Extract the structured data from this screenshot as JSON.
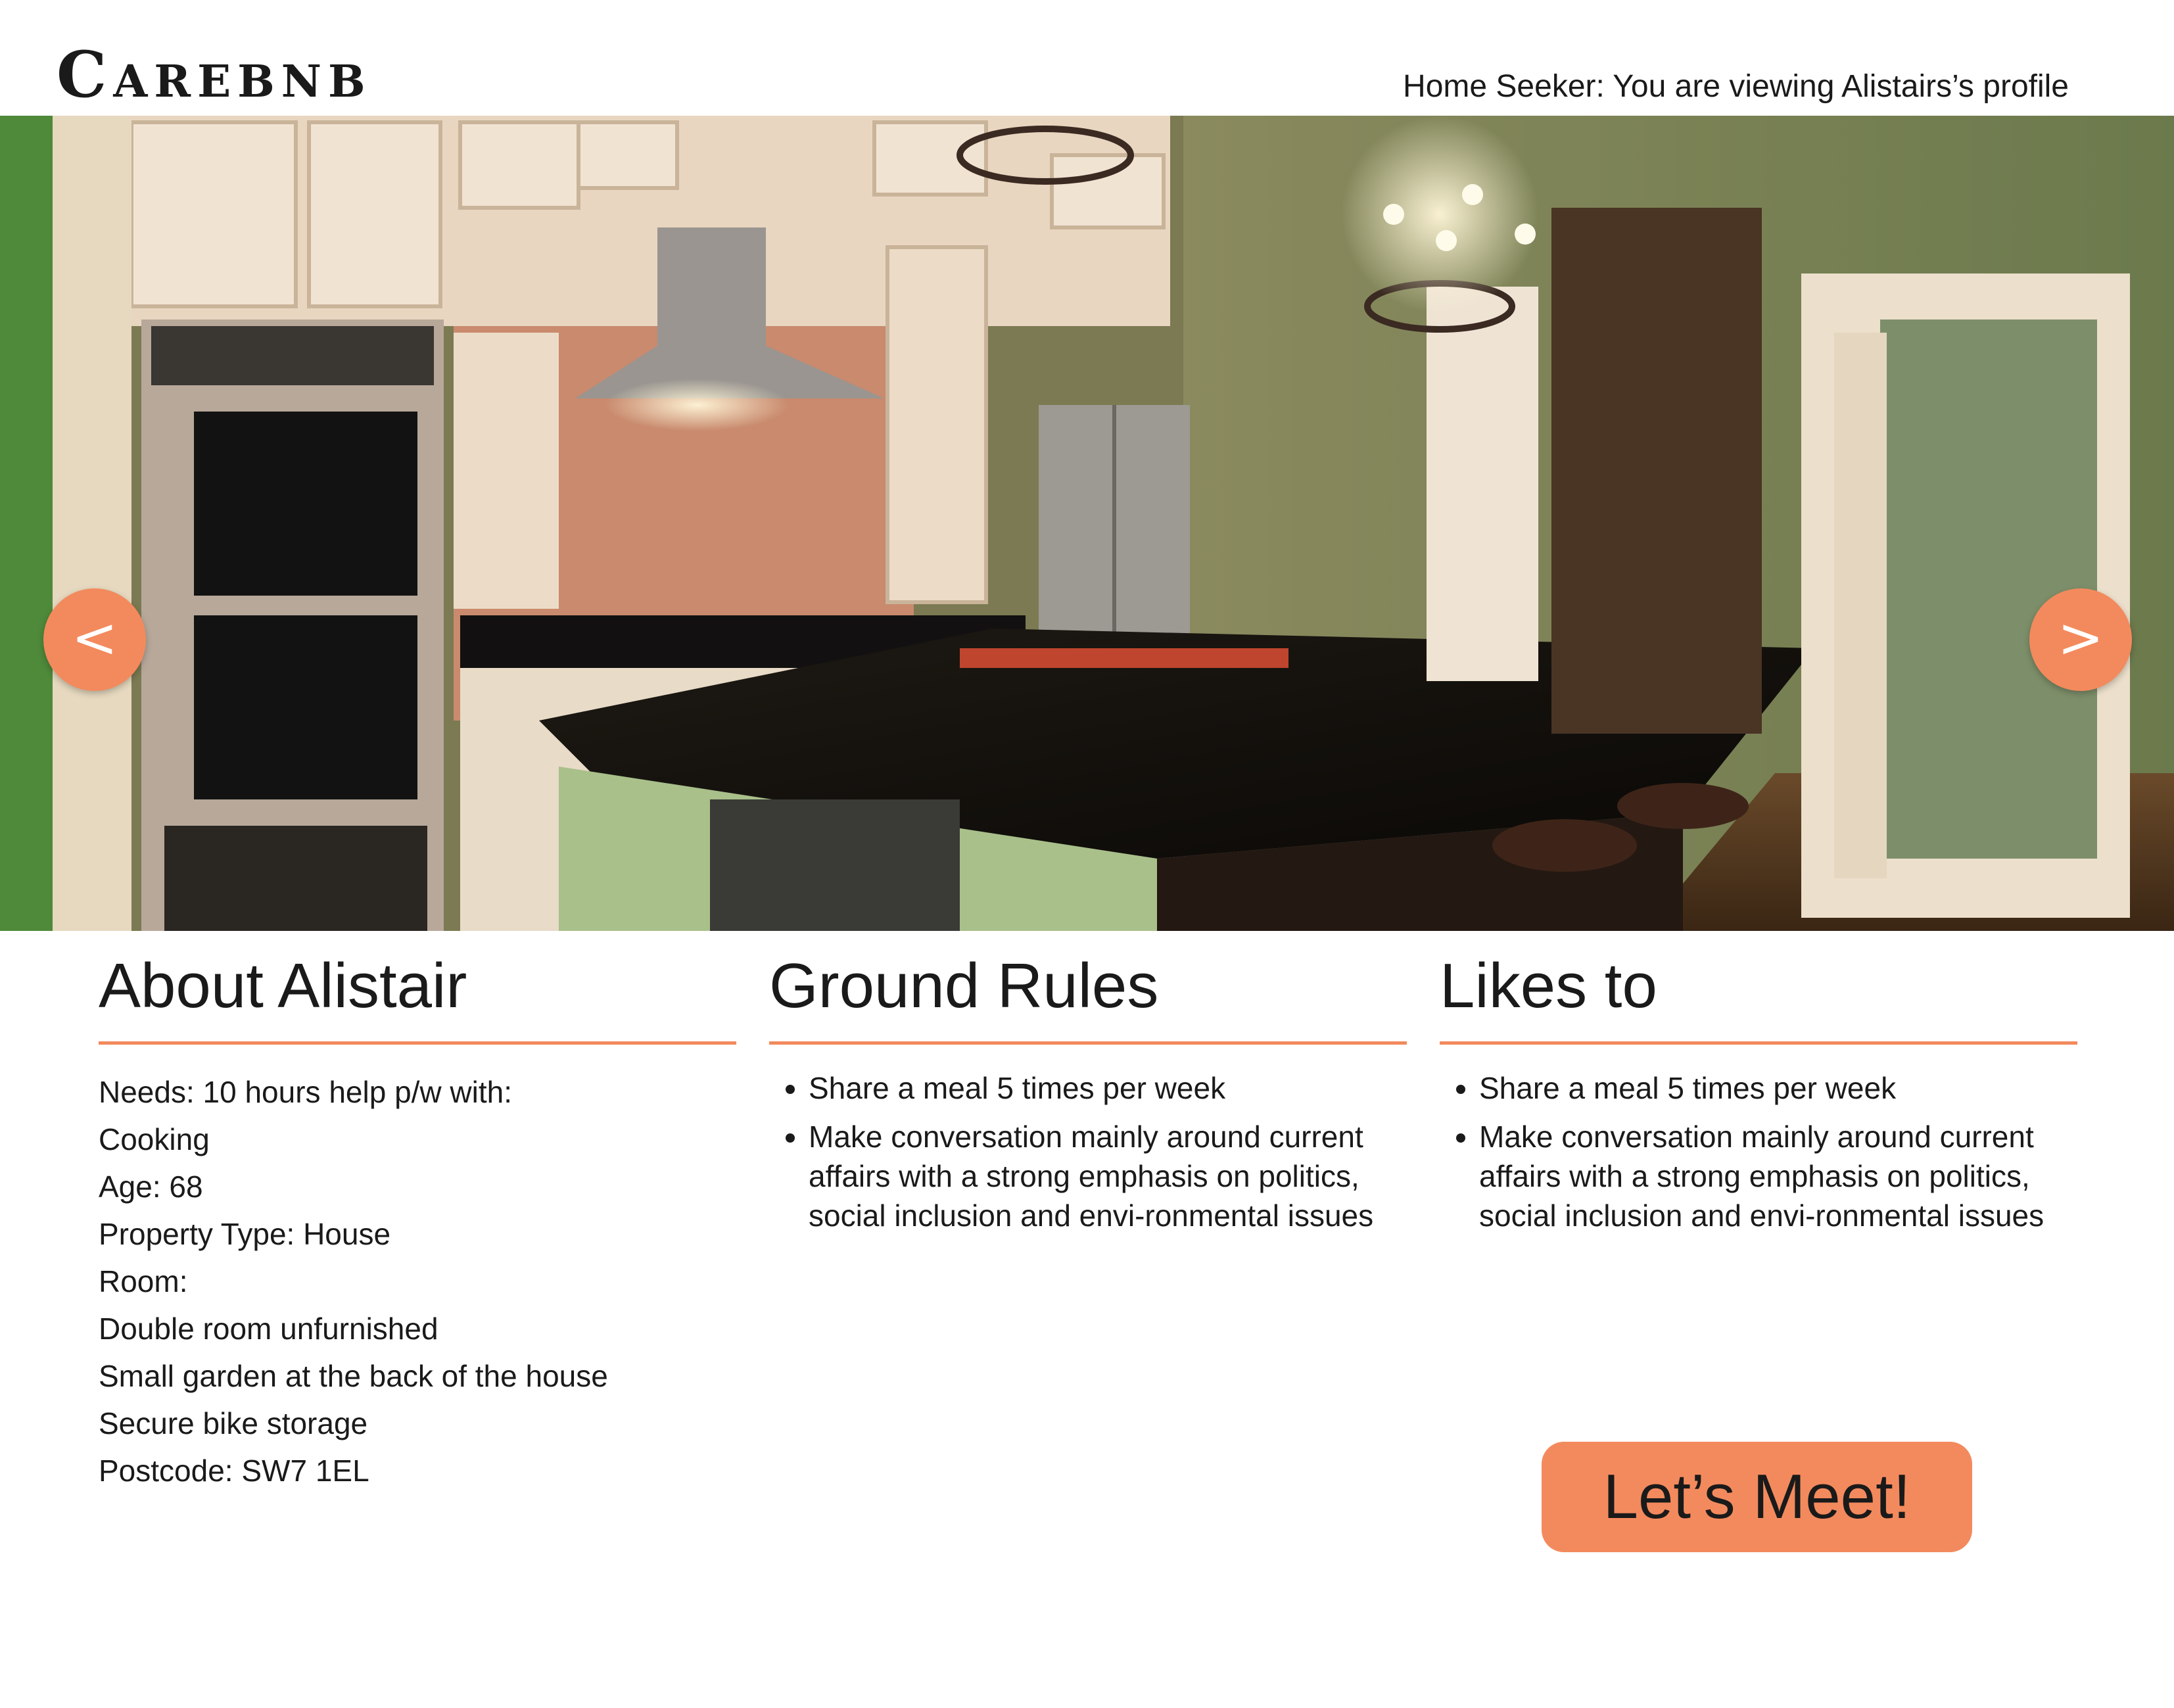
{
  "header": {
    "logo": "Carebnb",
    "viewer_note": "Home Seeker: You are viewing Alistairs’s profile"
  },
  "carousel": {
    "prev_label": "<",
    "next_label": ">",
    "image_subject": "kitchen interior photo"
  },
  "about": {
    "title": "About Alistair",
    "lines": [
      "Needs: 10 hours help p/w with:",
      "Cooking",
      "Age: 68",
      "Property Type: House",
      "Room:",
      "Double room unfurnished",
      "Small garden at the back of the house",
      "Secure bike storage",
      "Postcode: SW7 1EL"
    ]
  },
  "ground_rules": {
    "title": "Ground Rules",
    "items": [
      "Share a meal 5 times per week",
      "Make conversation mainly around current affairs with a strong emphasis on politics, social inclusion and envi-ronmental issues"
    ]
  },
  "likes": {
    "title": "Likes to",
    "items": [
      "Share a meal 5 times per week",
      "Make conversation mainly around current affairs with a strong emphasis on politics, social inclusion and envi-ronmental issues"
    ]
  },
  "cta": {
    "label": "Let’s Meet!"
  },
  "colors": {
    "accent": "#f38a5d",
    "text": "#1a1a1a",
    "background": "#ffffff"
  }
}
